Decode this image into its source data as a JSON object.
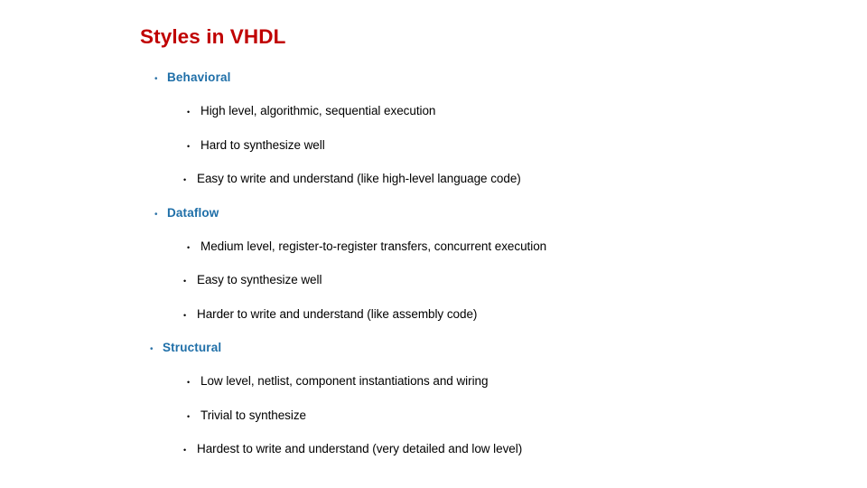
{
  "slide": {
    "title": "Styles in VHDL",
    "title_color": "#C00000",
    "heading_color": "#1F6FA8",
    "body_color": "#000000",
    "background_color": "#FFFFFF",
    "bullet_glyph": "•",
    "sections": [
      {
        "heading": "Behavioral",
        "items": [
          "High level, algorithmic, sequential execution",
          "Hard to synthesize well",
          "Easy to write and understand (like high-level language code)"
        ]
      },
      {
        "heading": "Dataflow",
        "items": [
          "Medium level, register-to-register transfers, concurrent execution",
          "Easy to synthesize well",
          "Harder to write and understand (like assembly code)"
        ]
      },
      {
        "heading": "Structural",
        "items": [
          "Low level, netlist, component instantiations and wiring",
          "Trivial to synthesize",
          "Hardest to write and understand (very detailed and low level)"
        ]
      }
    ]
  }
}
